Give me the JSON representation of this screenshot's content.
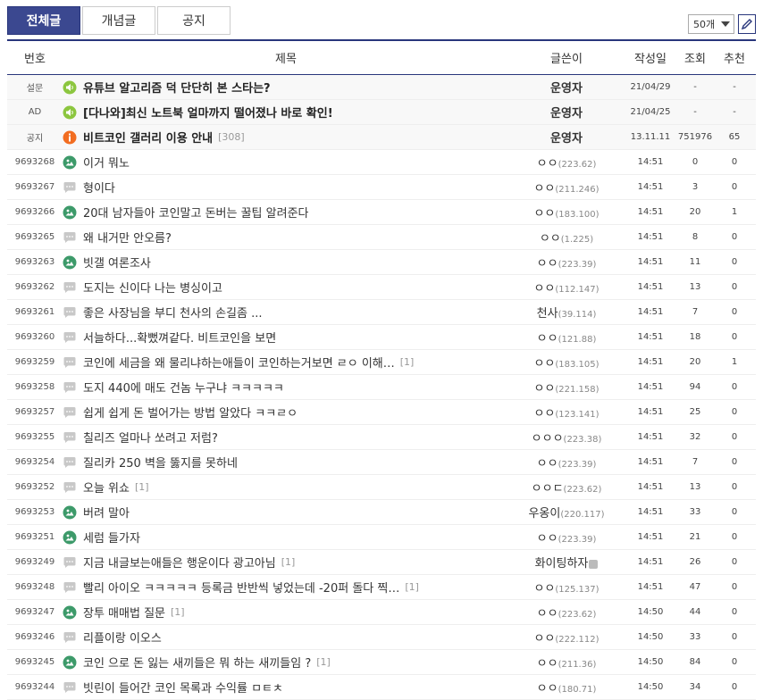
{
  "tabs": [
    {
      "label": "전체글",
      "active": true
    },
    {
      "label": "개념글",
      "active": false
    },
    {
      "label": "공지",
      "active": false
    }
  ],
  "page_size": {
    "value": "50개"
  },
  "header": {
    "num": "번호",
    "title": "제목",
    "writer": "글쓴이",
    "date": "작성일",
    "view": "조회",
    "rec": "추천"
  },
  "rows": [
    {
      "num": "설문",
      "icon": "speaker-icon",
      "title": "유튜브 알고리즘 덕 단단히 본 스타는?",
      "reply": "",
      "writer": "운영자",
      "ip": "",
      "date": "21/04/29",
      "view": "-",
      "rec": "-",
      "notice": true
    },
    {
      "num": "AD",
      "icon": "speaker-icon",
      "title": "[다나와]최신 노트북 얼마까지 떨어졌나 바로 확인!",
      "reply": "",
      "writer": "운영자",
      "ip": "",
      "date": "21/04/25",
      "view": "-",
      "rec": "-",
      "notice": true
    },
    {
      "num": "공지",
      "icon": "info-icon",
      "title": "비트코인 갤러리 이용 안내",
      "reply": "[308]",
      "writer": "운영자",
      "ip": "",
      "date": "13.11.11",
      "view": "751976",
      "rec": "65",
      "notice": true
    },
    {
      "num": "9693268",
      "icon": "image-post-icon",
      "title": "이거 뭐노",
      "reply": "",
      "writer": "ㅇㅇ",
      "ip": "(223.62)",
      "date": "14:51",
      "view": "0",
      "rec": "0"
    },
    {
      "num": "9693267",
      "icon": "text-post-icon",
      "title": "형이다",
      "reply": "",
      "writer": "ㅇㅇ",
      "ip": "(211.246)",
      "date": "14:51",
      "view": "3",
      "rec": "0"
    },
    {
      "num": "9693266",
      "icon": "image-post-icon",
      "title": "20대 남자들아 코인말고 돈버는 꿀팁 알려준다",
      "reply": "",
      "writer": "ㅇㅇ",
      "ip": "(183.100)",
      "date": "14:51",
      "view": "20",
      "rec": "1"
    },
    {
      "num": "9693265",
      "icon": "text-post-icon",
      "title": "왜 내거만 안오름?",
      "reply": "",
      "writer": "ㅇㅇ",
      "ip": "(1.225)",
      "date": "14:51",
      "view": "8",
      "rec": "0"
    },
    {
      "num": "9693263",
      "icon": "image-post-icon",
      "title": "빗갤 여론조사",
      "reply": "",
      "writer": "ㅇㅇ",
      "ip": "(223.39)",
      "date": "14:51",
      "view": "11",
      "rec": "0"
    },
    {
      "num": "9693262",
      "icon": "text-post-icon",
      "title": "도지는 신이다 나는 병싱이고",
      "reply": "",
      "writer": "ㅇㅇ",
      "ip": "(112.147)",
      "date": "14:51",
      "view": "13",
      "rec": "0"
    },
    {
      "num": "9693261",
      "icon": "text-post-icon",
      "title": "좋은 사장님을 부디 천사의 손길좀 ...",
      "reply": "",
      "writer": "천사",
      "ip": "(39.114)",
      "date": "14:51",
      "view": "7",
      "rec": "0"
    },
    {
      "num": "9693260",
      "icon": "text-post-icon",
      "title": "서늘하다...확뻤껴같다. 비트코인을 보면",
      "reply": "",
      "writer": "ㅇㅇ",
      "ip": "(121.88)",
      "date": "14:51",
      "view": "18",
      "rec": "0"
    },
    {
      "num": "9693259",
      "icon": "text-post-icon",
      "title": "코인에 세금을 왜 물리냐하는애들이 코인하는거보면 ㄹㅇ 이해…",
      "reply": "[1]",
      "writer": "ㅇㅇ",
      "ip": "(183.105)",
      "date": "14:51",
      "view": "20",
      "rec": "1"
    },
    {
      "num": "9693258",
      "icon": "text-post-icon",
      "title": "도지 440에 매도 건놈 누구냐 ㅋㅋㅋㅋㅋ",
      "reply": "",
      "writer": "ㅇㅇ",
      "ip": "(221.158)",
      "date": "14:51",
      "view": "94",
      "rec": "0"
    },
    {
      "num": "9693257",
      "icon": "text-post-icon",
      "title": "쉽게 쉽게 돈 벌어가는 방법 알았다 ㅋㅋㄹㅇ",
      "reply": "",
      "writer": "ㅇㅇ",
      "ip": "(123.141)",
      "date": "14:51",
      "view": "25",
      "rec": "0"
    },
    {
      "num": "9693255",
      "icon": "text-post-icon",
      "title": "칠리즈 얼마나 쏘려고 저럼?",
      "reply": "",
      "writer": "ㅇㅇㅇ",
      "ip": "(223.38)",
      "date": "14:51",
      "view": "32",
      "rec": "0"
    },
    {
      "num": "9693254",
      "icon": "text-post-icon",
      "title": "질리카 250 벽을 뚫지를 못하네",
      "reply": "",
      "writer": "ㅇㅇ",
      "ip": "(223.39)",
      "date": "14:51",
      "view": "7",
      "rec": "0"
    },
    {
      "num": "9693252",
      "icon": "text-post-icon",
      "title": "오늘 위쇼",
      "reply": "[1]",
      "writer": "ㅇㅇㄷ",
      "ip": "(223.62)",
      "date": "14:51",
      "view": "13",
      "rec": "0"
    },
    {
      "num": "9693253",
      "icon": "image-post-icon",
      "title": "버려 말아",
      "reply": "",
      "writer": "우옹이",
      "ip": "(220.117)",
      "date": "14:51",
      "view": "33",
      "rec": "0"
    },
    {
      "num": "9693251",
      "icon": "image-post-icon",
      "title": "세럼 들가자",
      "reply": "",
      "writer": "ㅇㅇ",
      "ip": "(223.39)",
      "date": "14:51",
      "view": "21",
      "rec": "0"
    },
    {
      "num": "9693249",
      "icon": "text-post-icon",
      "title": "지금 내글보는애들은 행운이다 광고아님",
      "reply": "[1]",
      "writer": "화이팅하자",
      "ip": "",
      "badge": true,
      "date": "14:51",
      "view": "26",
      "rec": "0"
    },
    {
      "num": "9693248",
      "icon": "text-post-icon",
      "title": "빨리 아이오 ㅋㅋㅋㅋㅋ 등록금 반반씩 넣었는데 -20퍼 돌다 찍…",
      "reply": "[1]",
      "writer": "ㅇㅇ",
      "ip": "(125.137)",
      "date": "14:51",
      "view": "47",
      "rec": "0"
    },
    {
      "num": "9693247",
      "icon": "image-post-icon",
      "title": "장투 매매법 질문",
      "reply": "[1]",
      "writer": "ㅇㅇ",
      "ip": "(223.62)",
      "date": "14:50",
      "view": "44",
      "rec": "0"
    },
    {
      "num": "9693246",
      "icon": "text-post-icon",
      "title": "리플이랑 이오스",
      "reply": "",
      "writer": "ㅇㅇ",
      "ip": "(222.112)",
      "date": "14:50",
      "view": "33",
      "rec": "0"
    },
    {
      "num": "9693245",
      "icon": "image-post-icon",
      "title": "코인 으로 돈 잃는 새끼들은 뭐 하는 새끼들임 ?",
      "reply": "[1]",
      "writer": "ㅇㅇ",
      "ip": "(211.36)",
      "date": "14:50",
      "view": "84",
      "rec": "0"
    },
    {
      "num": "9693244",
      "icon": "text-post-icon",
      "title": "빗린이 들어간 코인 목록과 수익률 ㅁㅌㅊ",
      "reply": "",
      "writer": "ㅇㅇ",
      "ip": "(180.71)",
      "date": "14:50",
      "view": "34",
      "rec": "0"
    }
  ]
}
